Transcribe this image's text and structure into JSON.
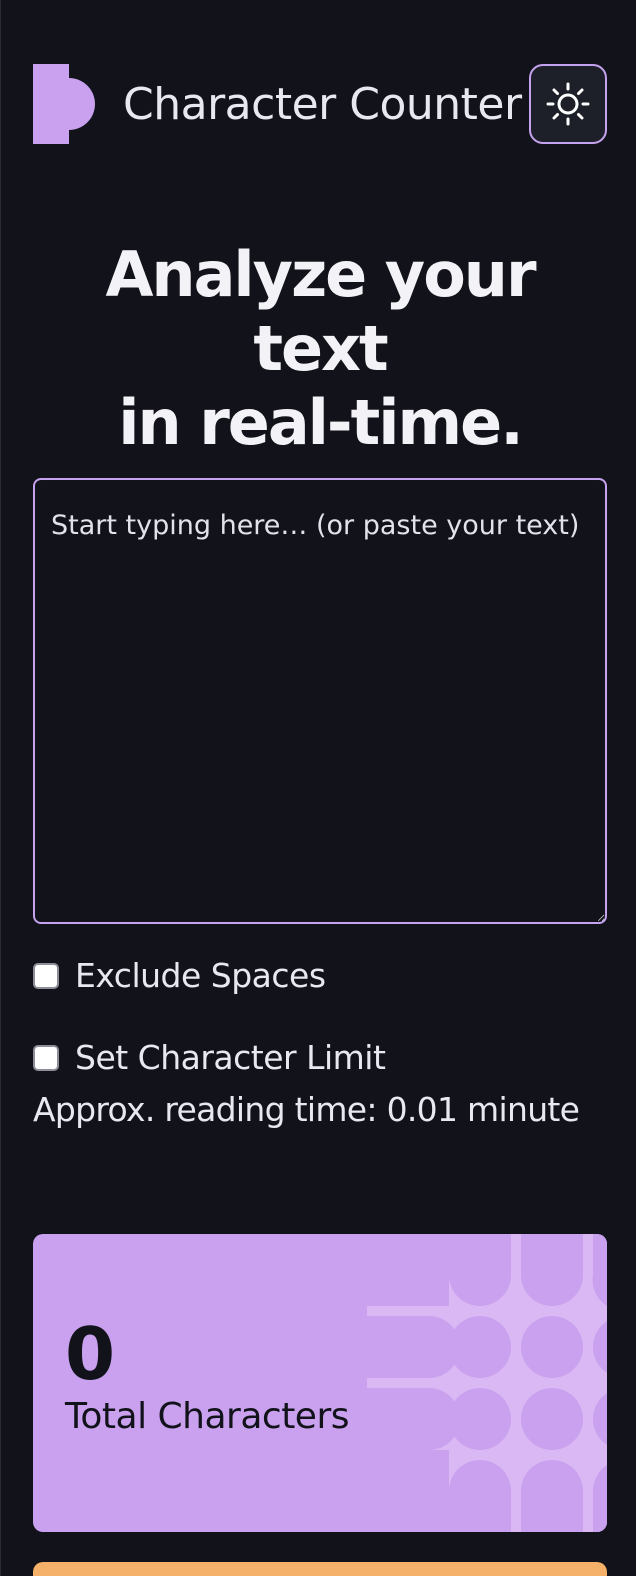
{
  "header": {
    "app_title": "Character Counter",
    "logo_icon": "half-circle-logo-icon",
    "theme_toggle_icon": "sun-icon"
  },
  "hero": {
    "headline_line1": "Analyze your text",
    "headline_line2": "in real-time."
  },
  "editor": {
    "placeholder": "Start typing here… (or paste your text)",
    "value": ""
  },
  "options": {
    "exclude_spaces_label": "Exclude Spaces",
    "exclude_spaces_checked": false,
    "char_limit_label": "Set Character Limit",
    "char_limit_checked": false
  },
  "reading_time": "Approx. reading time: 0.01 minute",
  "stats": [
    {
      "value": "0",
      "label": "Total Characters",
      "color": "#c9a1ef"
    }
  ],
  "colors": {
    "background": "#12131a",
    "accent": "#c5a2ee",
    "card_purple": "#c9a1ef",
    "card_orange": "#f5b06a"
  }
}
